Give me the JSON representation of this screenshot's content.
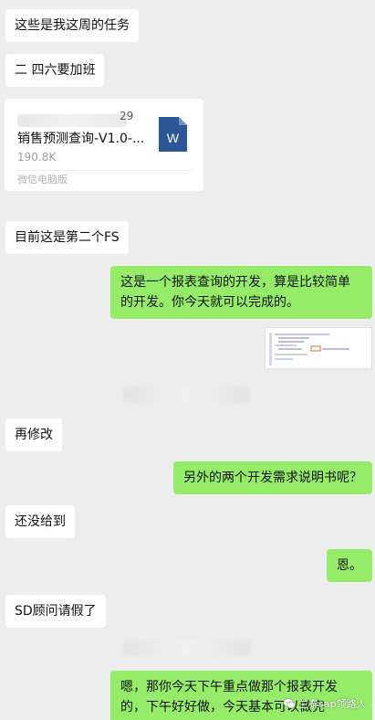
{
  "messages": [
    {
      "text": "这些是我这周的任务"
    },
    {
      "text": "二 四六要加班"
    },
    {
      "text": "目前这是第二个FS"
    },
    {
      "text": "这是一个报表查询的开发，算是比较简单的开发。你今天就可以完成的。"
    },
    {
      "text": "再修改"
    },
    {
      "text": "另外的两个开发需求说明书呢？"
    },
    {
      "text": "还没给到"
    },
    {
      "text": "恩。"
    },
    {
      "text": "SD顾问请假了"
    },
    {
      "text": "嗯，那你今天下午重点做那个报表开发的，下午好好做，今天基本可以做完"
    }
  ],
  "file": {
    "name_tail": "29",
    "name": "销售预测查询-V1.0-...",
    "size": "190.8K",
    "source": "微信电脑版",
    "icon_letter": "W",
    "icon_color": "#2b5797"
  },
  "watermark": {
    "text": "兰泰sap领路人"
  },
  "colors": {
    "background": "#ededed",
    "incoming_bubble": "#ffffff",
    "outgoing_bubble": "#95ec69"
  }
}
